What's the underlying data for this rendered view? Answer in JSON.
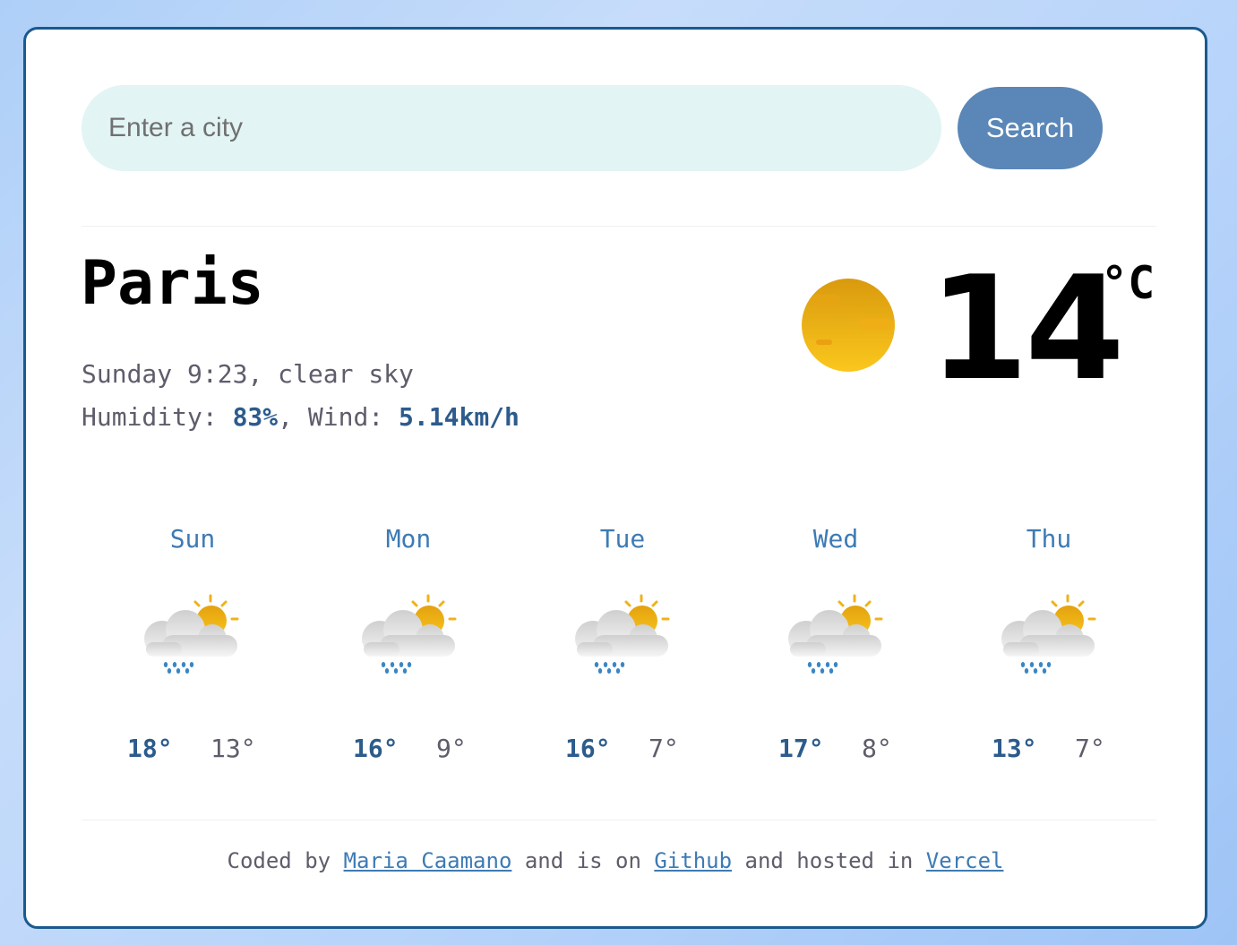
{
  "search": {
    "placeholder": "Enter a city",
    "value": "",
    "button_label": "Search"
  },
  "current": {
    "city": "Paris",
    "day": "Sunday",
    "time": "9:23",
    "description": "clear sky",
    "humidity_label": "Humidity:",
    "humidity_value": "83%",
    "wind_label": "Wind:",
    "wind_value": "5.14km/h",
    "temperature": "14",
    "unit": "°C",
    "icon": "clear-sky-icon"
  },
  "forecast": [
    {
      "day": "Sun",
      "max": "18°",
      "min": "13°",
      "icon": "partly-cloudy-rain-icon"
    },
    {
      "day": "Mon",
      "max": "16°",
      "min": "9°",
      "icon": "partly-cloudy-rain-icon"
    },
    {
      "day": "Tue",
      "max": "16°",
      "min": "7°",
      "icon": "partly-cloudy-rain-icon"
    },
    {
      "day": "Wed",
      "max": "17°",
      "min": "8°",
      "icon": "partly-cloudy-rain-icon"
    },
    {
      "day": "Thu",
      "max": "13°",
      "min": "7°",
      "icon": "partly-cloudy-rain-icon"
    }
  ],
  "footer": {
    "text1": "Coded by",
    "author_link": "Maria Caamano",
    "text2": "and is on",
    "github_link": "Github",
    "text3": "and hosted in",
    "vercel_link": "Vercel"
  },
  "colors": {
    "accent": "#5a87b7",
    "border": "#1a5a8e",
    "input_bg": "#e2f4f4",
    "emphasis": "#2c5b8c",
    "link": "#3d7bb4"
  }
}
